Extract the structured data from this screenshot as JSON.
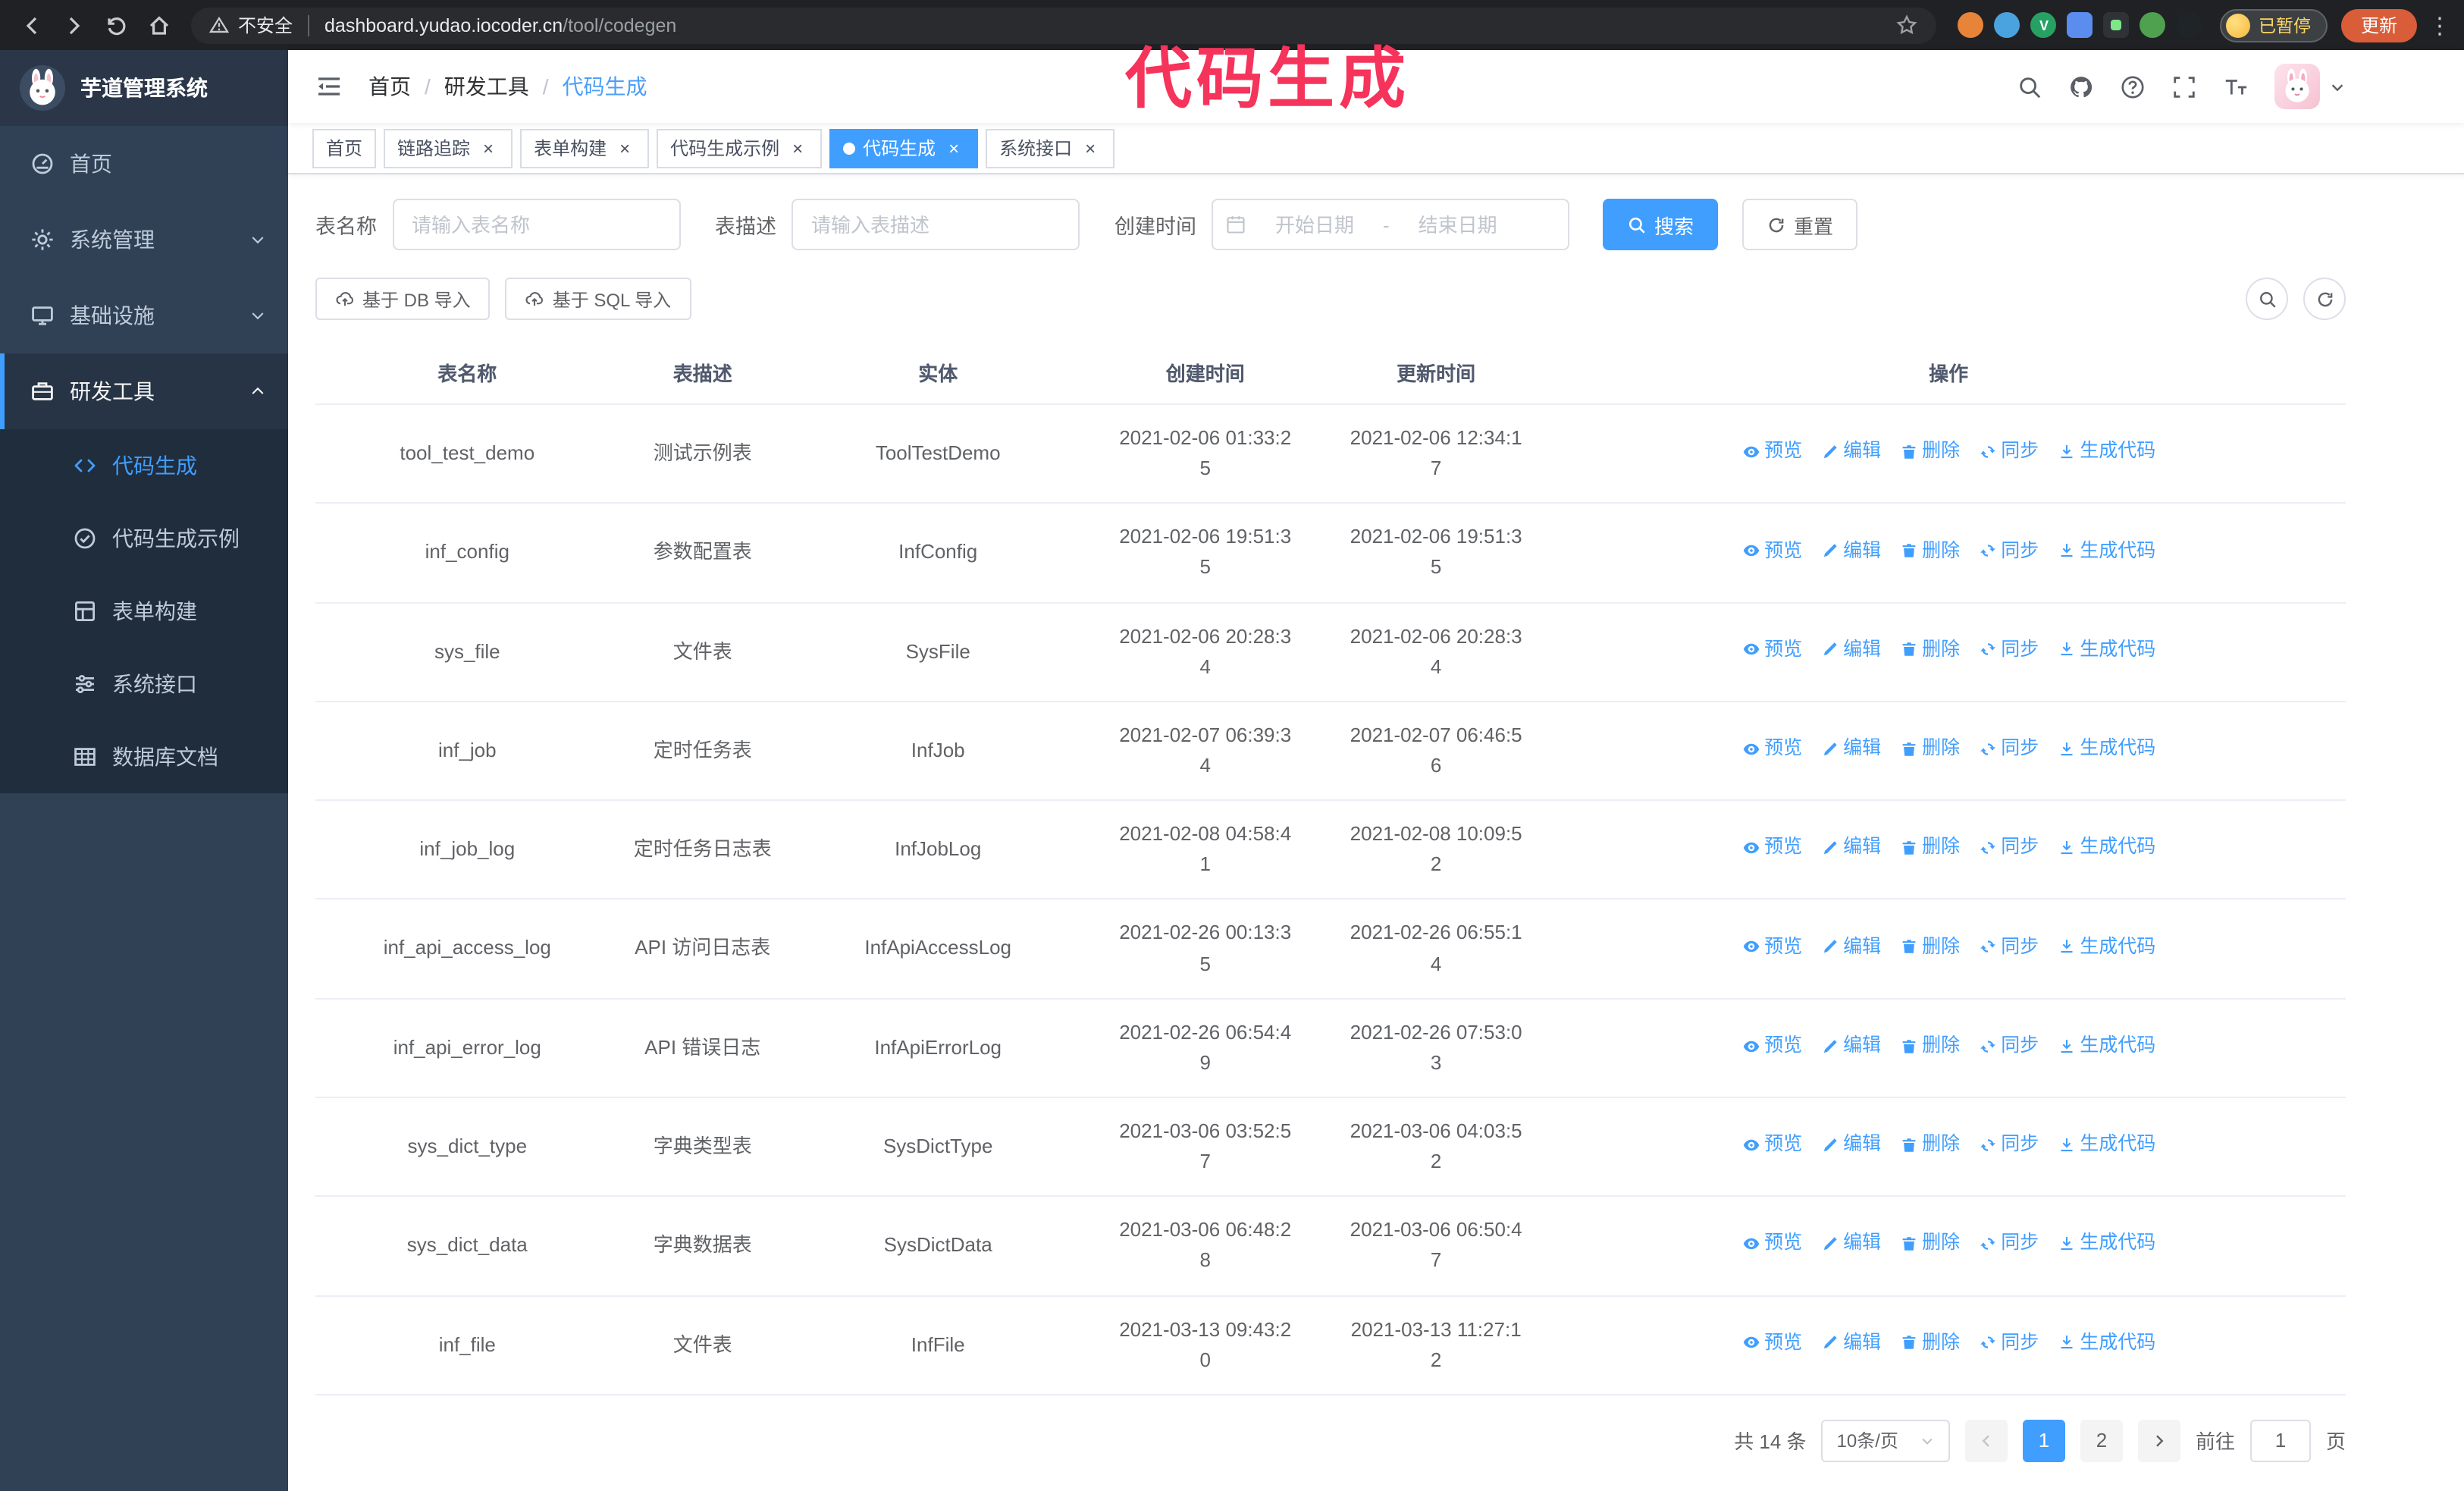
{
  "colors": {
    "accent": "#409eff",
    "sidebar_bg": "#304156",
    "submenu_bg": "#1f2d3d",
    "chrome_bg": "#202124",
    "annotation": "#f5335b",
    "update_button": "#d95d39",
    "active_tab_bg": "#409eff"
  },
  "icons": {
    "back": "arrow-left",
    "forward": "arrow-right",
    "reload": "circular-arrow",
    "home": "house",
    "warning": "triangle-exclamation",
    "star": "star-outline",
    "search": "magnifier",
    "github": "octocat",
    "help": "question-circle",
    "fullscreen": "expand-corners",
    "font_size": "double-T",
    "preview": "eye",
    "edit": "pencil",
    "delete": "trash",
    "sync": "circular-arrows",
    "generate": "download-arrow",
    "calendar": "calendar",
    "upload": "cloud-upload"
  },
  "annotation": {
    "text": "代码生成"
  },
  "browser": {
    "security_label": "不安全",
    "url_host": "dashboard.yudao.iocoder.cn",
    "url_path": "/tool/codegen",
    "profile_status": "已暂停",
    "update_label": "更新"
  },
  "sidebar": {
    "logo_title": "芋道管理系统",
    "items": [
      {
        "label": "首页",
        "expandable": false,
        "active": false
      },
      {
        "label": "系统管理",
        "expandable": true,
        "expanded": false,
        "active": false
      },
      {
        "label": "基础设施",
        "expandable": true,
        "expanded": false,
        "active": false
      },
      {
        "label": "研发工具",
        "expandable": true,
        "expanded": true,
        "active": true
      }
    ],
    "submenu": [
      {
        "label": "代码生成",
        "active": true
      },
      {
        "label": "代码生成示例",
        "active": false
      },
      {
        "label": "表单构建",
        "active": false
      },
      {
        "label": "系统接口",
        "active": false
      },
      {
        "label": "数据库文档",
        "active": false
      }
    ]
  },
  "header": {
    "breadcrumb": [
      "首页",
      "研发工具",
      "代码生成"
    ]
  },
  "tabs": [
    {
      "label": "首页",
      "closable": false,
      "active": false
    },
    {
      "label": "链路追踪",
      "closable": true,
      "active": false
    },
    {
      "label": "表单构建",
      "closable": true,
      "active": false
    },
    {
      "label": "代码生成示例",
      "closable": true,
      "active": false
    },
    {
      "label": "代码生成",
      "closable": true,
      "active": true
    },
    {
      "label": "系统接口",
      "closable": true,
      "active": false
    }
  ],
  "filters": {
    "table_name_label": "表名称",
    "table_name_placeholder": "请输入表名称",
    "table_desc_label": "表描述",
    "table_desc_placeholder": "请输入表描述",
    "create_time_label": "创建时间",
    "date_start_placeholder": "开始日期",
    "date_separator": "-",
    "date_end_placeholder": "结束日期",
    "search_button": "搜索",
    "reset_button": "重置"
  },
  "toolbar": {
    "import_db_button": "基于 DB 导入",
    "import_sql_button": "基于 SQL 导入"
  },
  "table": {
    "columns": [
      "表名称",
      "表描述",
      "实体",
      "创建时间",
      "更新时间",
      "操作"
    ],
    "action_labels": [
      "预览",
      "编辑",
      "删除",
      "同步",
      "生成代码"
    ],
    "rows": [
      {
        "name": "tool_test_demo",
        "desc": "测试示例表",
        "entity": "ToolTestDemo",
        "created": "2021-02-06 01:33:25",
        "updated": "2021-02-06 12:34:17"
      },
      {
        "name": "inf_config",
        "desc": "参数配置表",
        "entity": "InfConfig",
        "created": "2021-02-06 19:51:35",
        "updated": "2021-02-06 19:51:35"
      },
      {
        "name": "sys_file",
        "desc": "文件表",
        "entity": "SysFile",
        "created": "2021-02-06 20:28:34",
        "updated": "2021-02-06 20:28:34"
      },
      {
        "name": "inf_job",
        "desc": "定时任务表",
        "entity": "InfJob",
        "created": "2021-02-07 06:39:34",
        "updated": "2021-02-07 06:46:56"
      },
      {
        "name": "inf_job_log",
        "desc": "定时任务日志表",
        "entity": "InfJobLog",
        "created": "2021-02-08 04:58:41",
        "updated": "2021-02-08 10:09:52"
      },
      {
        "name": "inf_api_access_log",
        "desc": "API 访问日志表",
        "entity": "InfApiAccessLog",
        "created": "2021-02-26 00:13:35",
        "updated": "2021-02-26 06:55:14"
      },
      {
        "name": "inf_api_error_log",
        "desc": "API 错误日志",
        "entity": "InfApiErrorLog",
        "created": "2021-02-26 06:54:49",
        "updated": "2021-02-26 07:53:03"
      },
      {
        "name": "sys_dict_type",
        "desc": "字典类型表",
        "entity": "SysDictType",
        "created": "2021-03-06 03:52:57",
        "updated": "2021-03-06 04:03:52"
      },
      {
        "name": "sys_dict_data",
        "desc": "字典数据表",
        "entity": "SysDictData",
        "created": "2021-03-06 06:48:28",
        "updated": "2021-03-06 06:50:47"
      },
      {
        "name": "inf_file",
        "desc": "文件表",
        "entity": "InfFile",
        "created": "2021-03-13 09:43:20",
        "updated": "2021-03-13 11:27:12"
      }
    ]
  },
  "pagination": {
    "total_label": "共 14 条",
    "page_size_label": "10条/页",
    "pages": [
      "1",
      "2"
    ],
    "active_page": "1",
    "goto_label": "前往",
    "goto_value": "1",
    "goto_unit": "页"
  }
}
